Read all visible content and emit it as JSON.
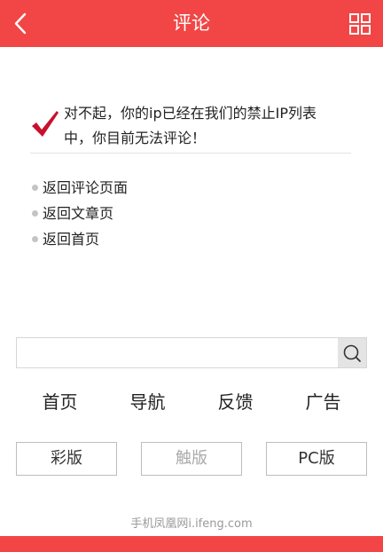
{
  "header": {
    "title": "评论",
    "back_icon": "chevron-left-icon",
    "menu_icon": "grid-icon",
    "background": "#f24646"
  },
  "notice": {
    "icon": "checkmark-icon",
    "icon_color": "#c8102e",
    "line1": "对不起，你的ip已经在我们的禁止IP列表",
    "line2": "中，你目前无法评论！"
  },
  "links": [
    "返回评论页面",
    "返回文章页",
    "返回首页"
  ],
  "search": {
    "value": "",
    "placeholder": "",
    "icon": "search-icon"
  },
  "nav": [
    "首页",
    "导航",
    "反馈",
    "广告"
  ],
  "versions": [
    {
      "label": "彩版",
      "active": true
    },
    {
      "label": "触版",
      "active": false
    },
    {
      "label": "PC版",
      "active": true
    }
  ],
  "footer": {
    "text": "手机凤凰网i.ifeng.com"
  }
}
